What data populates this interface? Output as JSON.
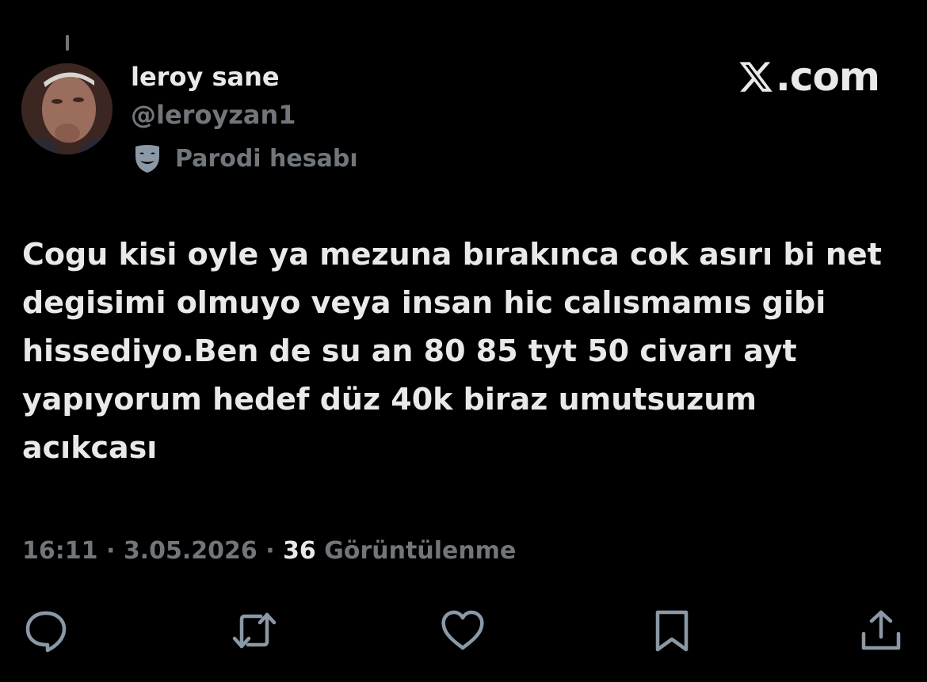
{
  "user": {
    "display_name": "leroy sane",
    "handle": "@leroyzan1",
    "label": "Parodi hesabı",
    "label_icon": "mask-icon"
  },
  "brand": {
    "logo": "x-logo-icon",
    "text": ".com"
  },
  "tweet": {
    "text": "Cogu kisi oyle ya mezuna bırakınca cok asırı bi net degisimi olmuyo veya insan hic calısmamıs gibi hissediyo.Ben de su an 80 85 tyt 50 civarı ayt yapıyorum hedef düz 40k biraz umutsuzum acıkcası",
    "time": "16:11",
    "date": "3.05.2026",
    "separator": "·",
    "views_count": "36",
    "views_label": "Görüntülenme"
  },
  "actions": [
    {
      "icon": "reply-icon"
    },
    {
      "icon": "retweet-icon"
    },
    {
      "icon": "like-icon"
    },
    {
      "icon": "bookmark-icon"
    },
    {
      "icon": "share-icon"
    }
  ],
  "colors": {
    "background": "#000000",
    "primary_text": "#e7e9ea",
    "secondary_text": "#71767b"
  }
}
